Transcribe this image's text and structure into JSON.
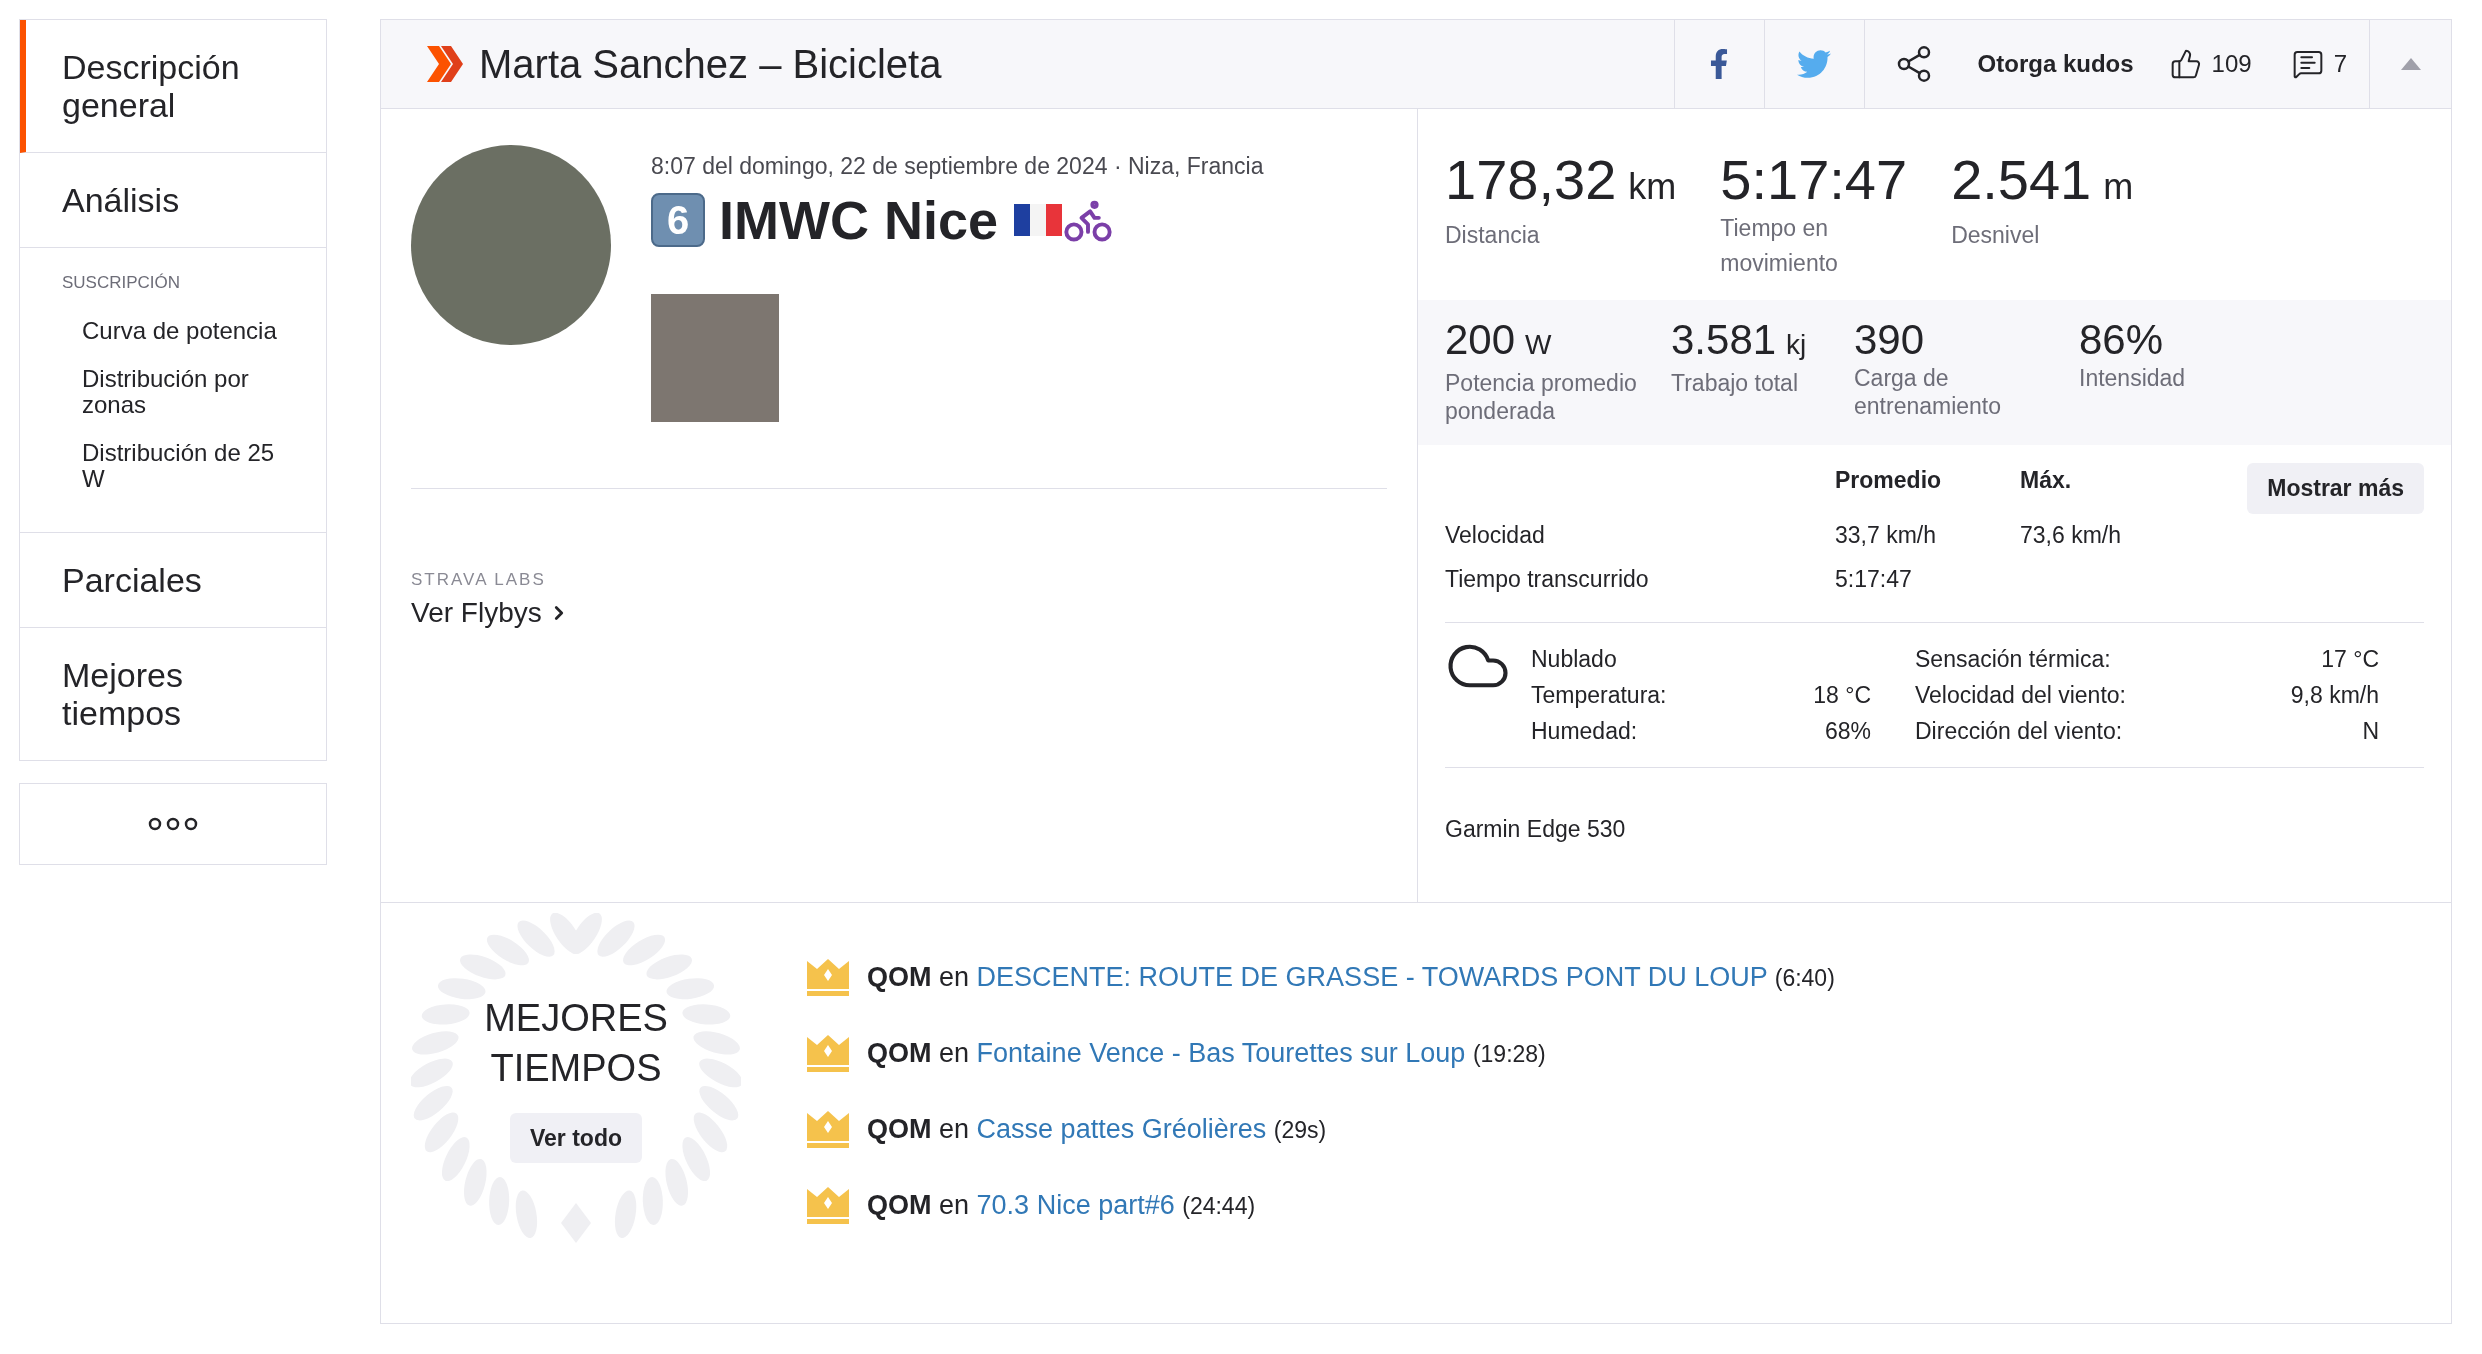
{
  "sidebar": {
    "items": [
      {
        "kind": "main",
        "label": "Descripción general",
        "selected": true
      },
      {
        "kind": "main",
        "label": "Análisis",
        "selected": false
      },
      {
        "kind": "section",
        "label": "SUSCRIPCIÓN",
        "children": [
          {
            "label": "Curva de potencia",
            "selected": false
          },
          {
            "label": "Distribución por zonas",
            "selected": false
          },
          {
            "label": "Distribución de 25 W",
            "selected": false
          }
        ]
      },
      {
        "kind": "main",
        "label": "Parciales",
        "selected": false
      },
      {
        "kind": "main",
        "label": "Mejores tiempos",
        "selected": false
      }
    ]
  },
  "header": {
    "title": "Marta Sanchez – Bicicleta",
    "kudos_label": "Otorga kudos",
    "kudos_count": "109",
    "comments_count": "7"
  },
  "activity": {
    "datetime_location": "8:07 del domingo, 22 de septiembre de 2024 · Niza, Francia",
    "title_badge": "6",
    "name": "IMWC Nice",
    "labs_label": "STRAVA LABS",
    "flybys_link": "Ver Flybys"
  },
  "primary_stats": [
    {
      "value": "178,32",
      "unit": "km",
      "label": "Distancia"
    },
    {
      "value": "5:17:47",
      "label": "Tiempo en movimiento"
    },
    {
      "value": "2.541",
      "unit": "m",
      "label": "Desnivel"
    }
  ],
  "secondary_stats": [
    {
      "value": "200",
      "unit": "W",
      "label": "Potencia promedio ponderada"
    },
    {
      "value": "3.581",
      "unit": "kj",
      "label": "Trabajo total"
    },
    {
      "value": "390",
      "label": "Carga de entrenamiento"
    },
    {
      "value": "86%",
      "label": "Intensidad"
    }
  ],
  "details_table": {
    "columns": [
      "Promedio",
      "Máx."
    ],
    "button": "Mostrar más",
    "rows": [
      {
        "label": "Velocidad",
        "values": [
          "33,7 km/h",
          "73,6 km/h"
        ]
      },
      {
        "label": "Tiempo transcurrido",
        "values": [
          "5:17:47"
        ]
      }
    ]
  },
  "weather": {
    "condition": "Nublado",
    "left": [
      {
        "label": "Temperatura:",
        "value": "18 °C"
      },
      {
        "label": "Humedad:",
        "value": "68%"
      }
    ],
    "right": [
      {
        "label": "Sensación térmica:",
        "value": "17 °C"
      },
      {
        "label": "Velocidad del viento:",
        "value": "9,8 km/h"
      },
      {
        "label": "Dirección del viento:",
        "value": "N"
      }
    ]
  },
  "device": "Garmin Edge 530",
  "best_efforts": {
    "title": "MEJORES TIEMPOS",
    "button": "Ver todo",
    "items": [
      {
        "achievement": "QOM",
        "connector": "en",
        "segment": "DESCENTE: ROUTE DE GRASSE - TOWARDS PONT DU LOUP",
        "time": "(6:40)"
      },
      {
        "achievement": "QOM",
        "connector": "en",
        "segment": "Fontaine Vence - Bas Tourettes sur Loup",
        "time": "(19:28)"
      },
      {
        "achievement": "QOM",
        "connector": "en",
        "segment": "Casse pattes Gréolières",
        "time": "(29s)"
      },
      {
        "achievement": "QOM",
        "connector": "en",
        "segment": "70.3 Nice part#6",
        "time": "(24:44)"
      }
    ]
  }
}
